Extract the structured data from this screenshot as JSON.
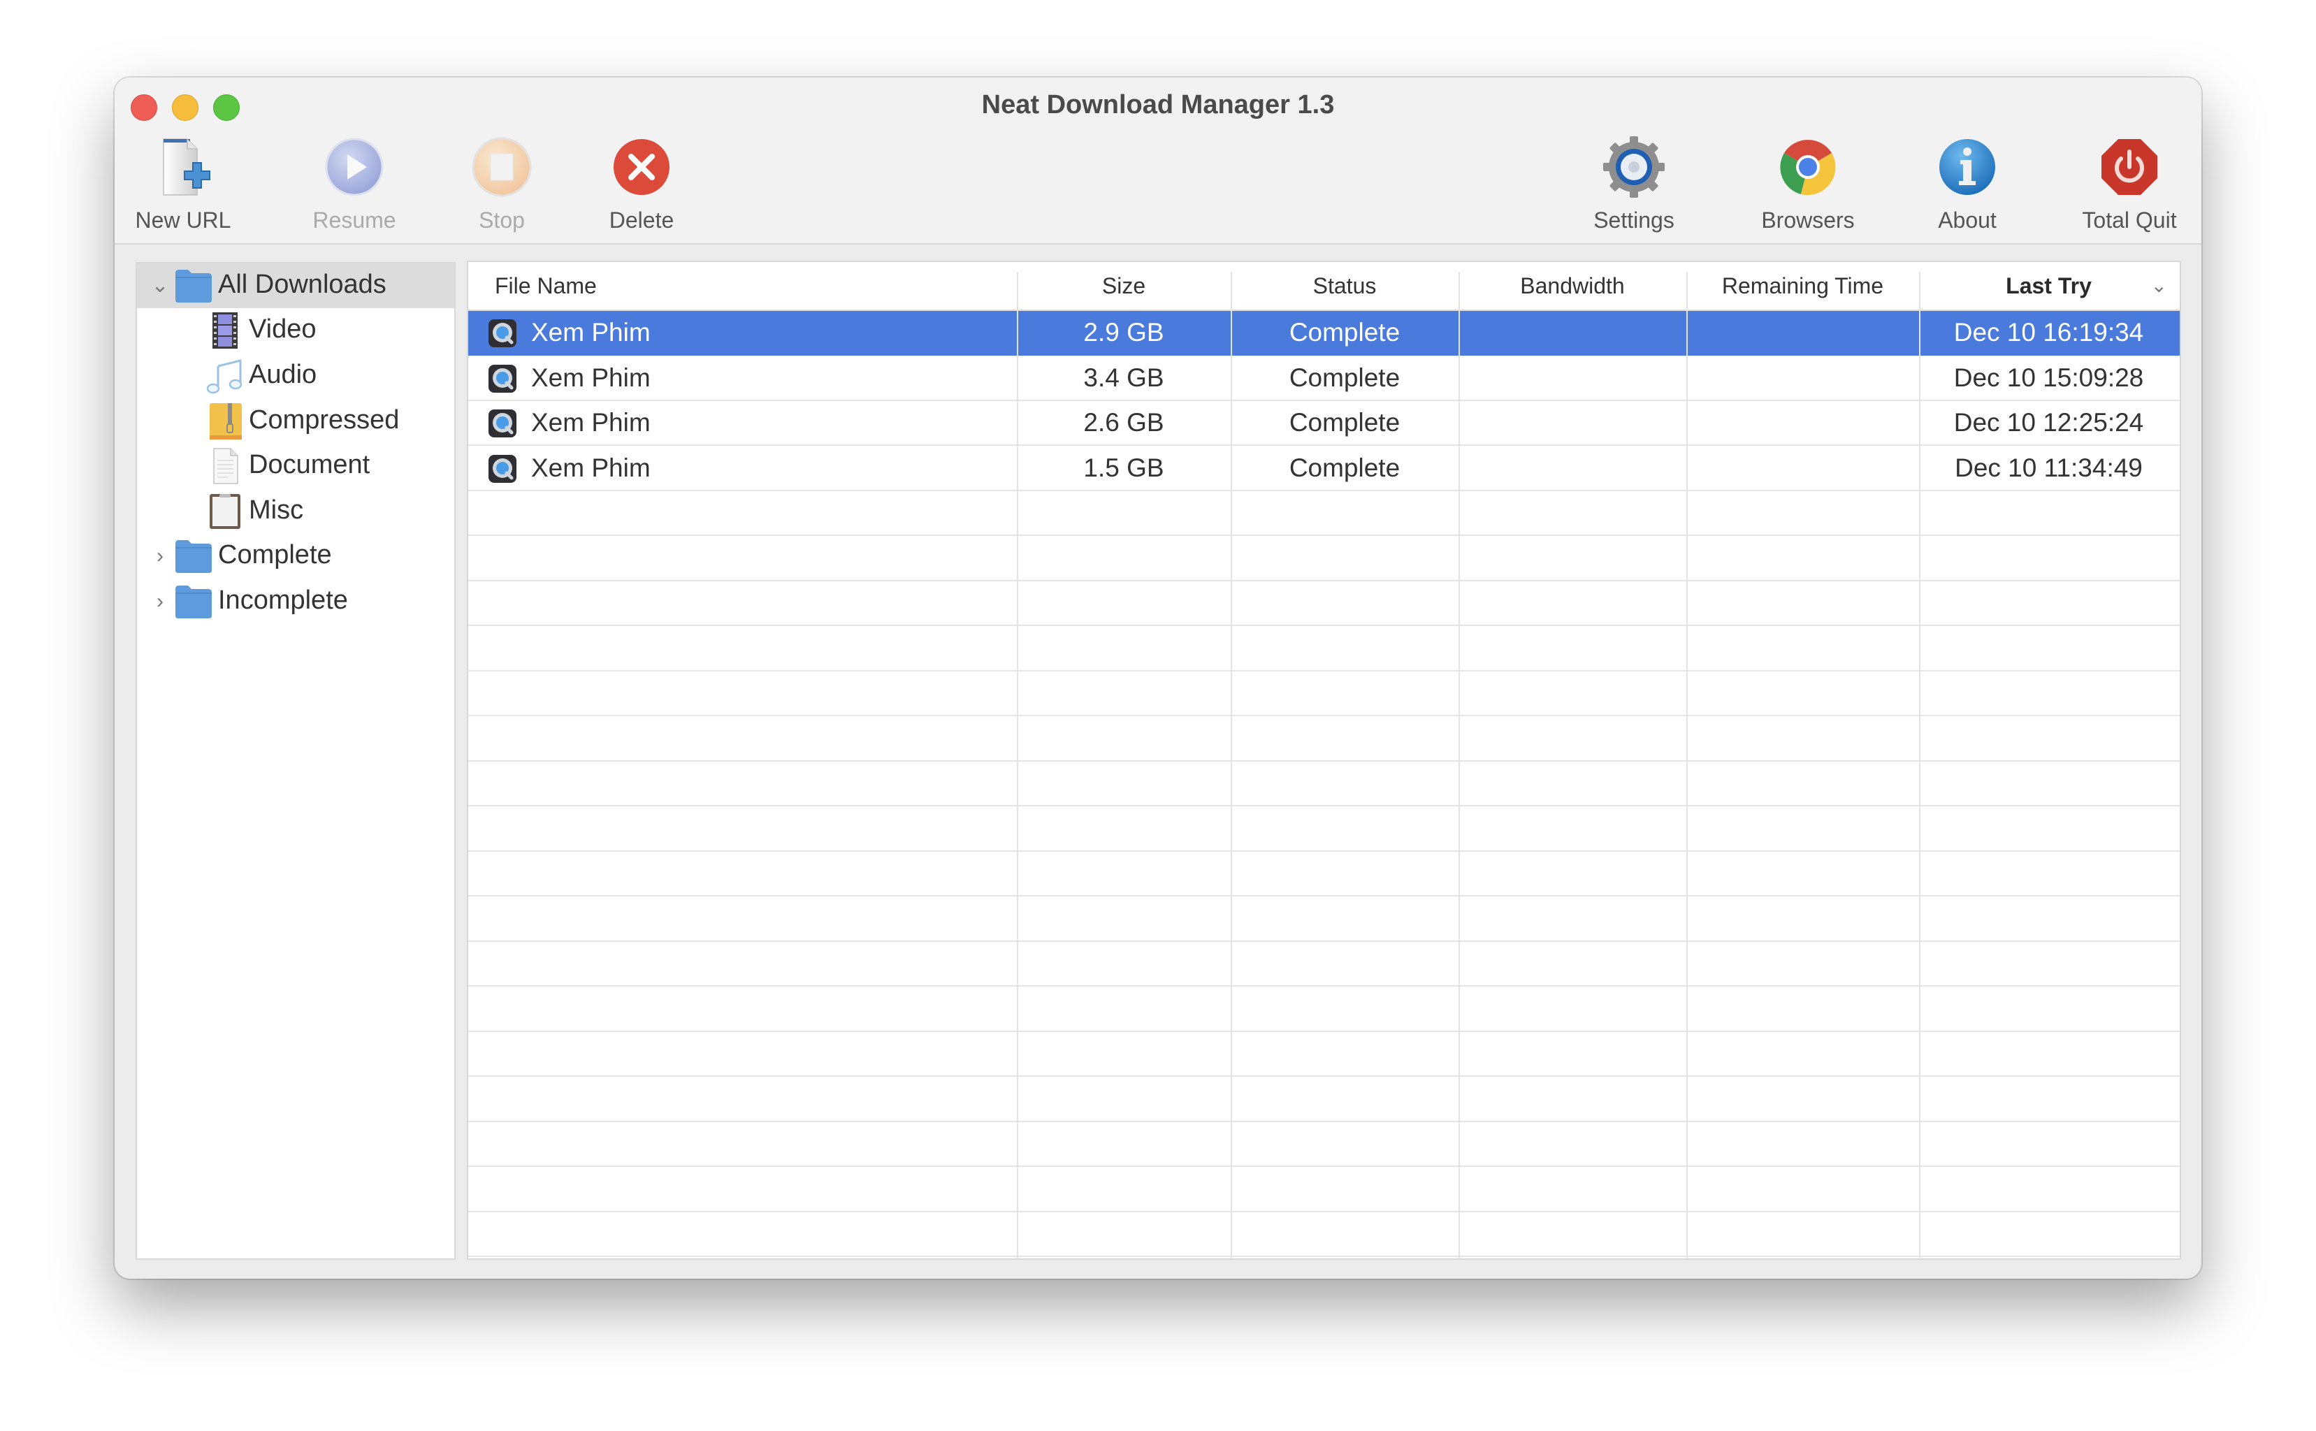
{
  "window": {
    "title": "Neat Download Manager 1.3"
  },
  "toolbar": {
    "left": [
      {
        "id": "new-url",
        "label": "New URL",
        "icon": "new-url-icon",
        "enabled": true
      },
      {
        "id": "resume",
        "label": "Resume",
        "icon": "play-icon",
        "enabled": false
      },
      {
        "id": "stop",
        "label": "Stop",
        "icon": "stop-icon",
        "enabled": false
      },
      {
        "id": "delete",
        "label": "Delete",
        "icon": "delete-icon",
        "enabled": true
      }
    ],
    "right": [
      {
        "id": "settings",
        "label": "Settings",
        "icon": "gear-icon",
        "enabled": true
      },
      {
        "id": "browsers",
        "label": "Browsers",
        "icon": "chrome-icon",
        "enabled": true
      },
      {
        "id": "about",
        "label": "About",
        "icon": "info-icon",
        "enabled": true
      },
      {
        "id": "total-quit",
        "label": "Total Quit",
        "icon": "power-icon",
        "enabled": true
      }
    ]
  },
  "sidebar": {
    "items": [
      {
        "label": "All Downloads",
        "icon": "folder-icon",
        "level": 0,
        "expanded": true,
        "selected": true
      },
      {
        "label": "Video",
        "icon": "film-icon",
        "level": 1
      },
      {
        "label": "Audio",
        "icon": "music-note-icon",
        "level": 1
      },
      {
        "label": "Compressed",
        "icon": "archive-icon",
        "level": 1
      },
      {
        "label": "Document",
        "icon": "document-icon",
        "level": 1
      },
      {
        "label": "Misc",
        "icon": "clipboard-icon",
        "level": 1
      },
      {
        "label": "Complete",
        "icon": "folder-icon",
        "level": 0,
        "expanded": false
      },
      {
        "label": "Incomplete",
        "icon": "folder-icon",
        "level": 0,
        "expanded": false
      }
    ]
  },
  "table": {
    "columns": [
      "File Name",
      "Size",
      "Status",
      "Bandwidth",
      "Remaining Time",
      "Last Try"
    ],
    "sorted_column": "Last Try",
    "sort_direction": "descending",
    "rows": [
      {
        "file_name": "Xem Phim",
        "size": "2.9 GB",
        "status": "Complete",
        "bandwidth": "",
        "remaining_time": "",
        "last_try": "Dec 10  16:19:34",
        "selected": true
      },
      {
        "file_name": "Xem Phim",
        "size": "3.4 GB",
        "status": "Complete",
        "bandwidth": "",
        "remaining_time": "",
        "last_try": "Dec 10  15:09:28"
      },
      {
        "file_name": "Xem Phim",
        "size": "2.6 GB",
        "status": "Complete",
        "bandwidth": "",
        "remaining_time": "",
        "last_try": "Dec 10  12:25:24"
      },
      {
        "file_name": "Xem Phim",
        "size": "1.5 GB",
        "status": "Complete",
        "bandwidth": "",
        "remaining_time": "",
        "last_try": "Dec 10  11:34:49"
      }
    ]
  },
  "colors": {
    "selection": "#4a7bdc",
    "sidebar_selection": "#dcdcdc",
    "folder": "#5e9bdc"
  }
}
